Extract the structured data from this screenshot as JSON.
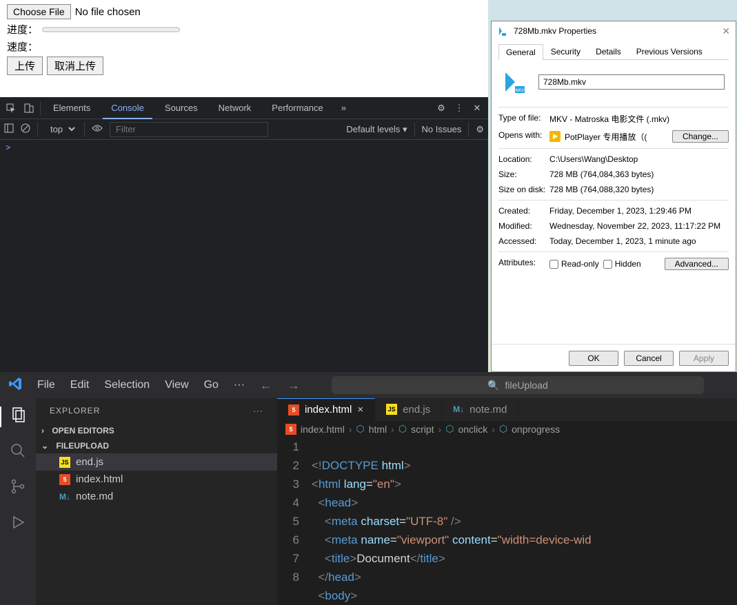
{
  "upload": {
    "choose": "Choose File",
    "nofile": "No file chosen",
    "progress_label": "进度：",
    "speed_label": "速度：",
    "upload_btn": "上传",
    "cancel_btn": "取消上传"
  },
  "devtools": {
    "tabs": [
      "Elements",
      "Console",
      "Sources",
      "Network",
      "Performance"
    ],
    "active_tab": "Console",
    "more": "»",
    "context": "top",
    "filter_placeholder": "Filter",
    "levels": "Default levels",
    "no_issues": "No Issues",
    "prompt": ">"
  },
  "props": {
    "title": "728Mb.mkv Properties",
    "tabs": [
      "General",
      "Security",
      "Details",
      "Previous Versions"
    ],
    "active_tab": "General",
    "filename": "728Mb.mkv",
    "type_k": "Type of file:",
    "type_v": "MKV - Matroska 电影文件 (.mkv)",
    "opens_k": "Opens with:",
    "opens_v": "PotPlayer 专用播放（(",
    "change": "Change...",
    "loc_k": "Location:",
    "loc_v": "C:\\Users\\Wang\\Desktop",
    "size_k": "Size:",
    "size_v": "728 MB (764,084,363 bytes)",
    "disk_k": "Size on disk:",
    "disk_v": "728 MB (764,088,320 bytes)",
    "created_k": "Created:",
    "created_v": "Friday, December 1, 2023, 1:29:46 PM",
    "modified_k": "Modified:",
    "modified_v": "Wednesday, November 22, 2023, 11:17:22 PM",
    "accessed_k": "Accessed:",
    "accessed_v": "Today, December 1, 2023, 1 minute ago",
    "attrs_k": "Attributes:",
    "readonly": "Read-only",
    "hidden": "Hidden",
    "advanced": "Advanced...",
    "ok": "OK",
    "cancel": "Cancel",
    "apply": "Apply"
  },
  "vscode": {
    "menu": [
      "File",
      "Edit",
      "Selection",
      "View",
      "Go"
    ],
    "menu_more": "···",
    "search": "fileUpload",
    "explorer": "EXPLORER",
    "open_editors": "OPEN EDITORS",
    "project": "FILEUPLOAD",
    "files": [
      {
        "icon": "js",
        "name": "end.js"
      },
      {
        "icon": "html",
        "name": "index.html"
      },
      {
        "icon": "md",
        "name": "note.md"
      }
    ],
    "tabs": [
      {
        "icon": "html",
        "name": "index.html",
        "active": true
      },
      {
        "icon": "js",
        "name": "end.js",
        "active": false
      },
      {
        "icon": "md",
        "name": "note.md",
        "active": false
      }
    ],
    "breadcrumb": [
      "index.html",
      "html",
      "script",
      "onclick",
      "onprogress"
    ],
    "code_lines": [
      1,
      2,
      3,
      4,
      5,
      6,
      7,
      8
    ]
  }
}
